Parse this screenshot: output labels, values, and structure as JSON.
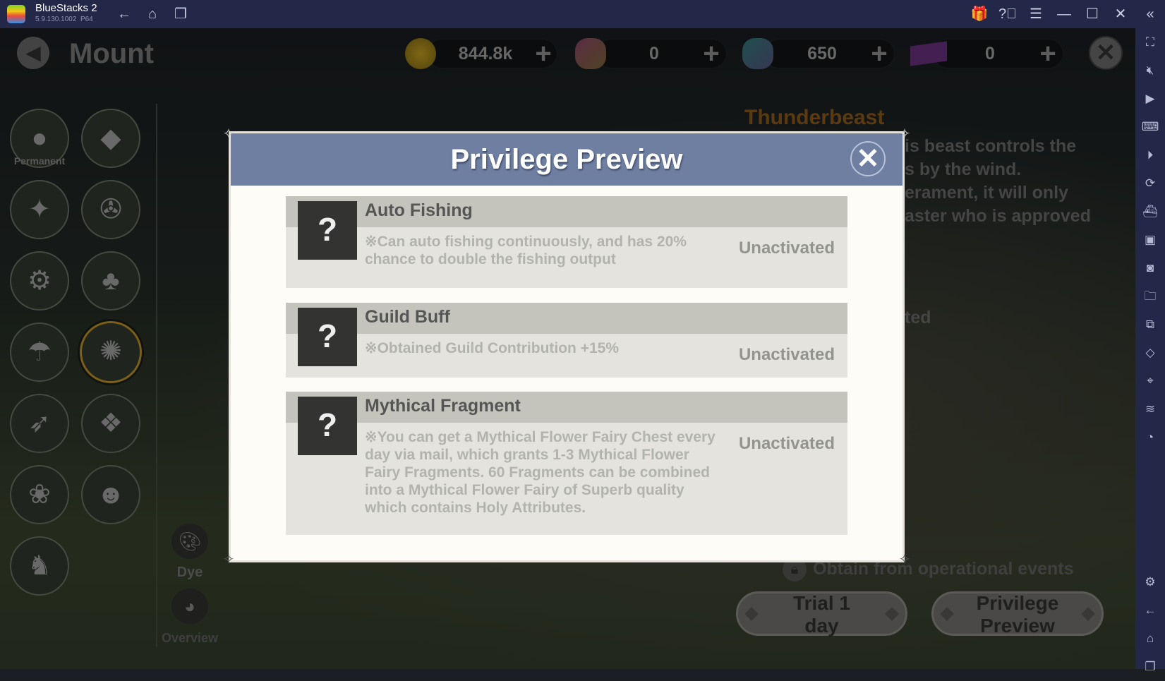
{
  "titlebar": {
    "app_name": "BlueStacks 2",
    "version": "5.9.130.1002  P64"
  },
  "page": {
    "title": "Mount"
  },
  "currencies": [
    {
      "icon": "gold-coin-icon",
      "value": "844.8k"
    },
    {
      "icon": "pink-crystal-icon",
      "value": "0"
    },
    {
      "icon": "blue-crystal-icon",
      "value": "650"
    },
    {
      "icon": "purple-ticket-icon",
      "value": "0"
    }
  ],
  "mounts": [
    {
      "label": "Permanent"
    },
    {},
    {},
    {},
    {},
    {},
    {},
    {},
    {},
    {},
    {},
    {},
    {}
  ],
  "side_actions": {
    "dye": "Dye",
    "overview": "Overview"
  },
  "detail": {
    "name": "Thunderbeast",
    "description_fragments": [
      "is beast controls the",
      "s by the wind.",
      "erament, it will only",
      "aster who is approved"
    ],
    "status_fragment": "ted",
    "obtain": "Obtain from operational events",
    "trial_button": "Trial 1 day",
    "privilege_button": "Privilege Preview"
  },
  "modal": {
    "title": "Privilege Preview",
    "privileges": [
      {
        "name": "Auto Fishing",
        "description": "※Can auto fishing continuously, and has 20% chance to double the fishing output",
        "status": "Unactivated"
      },
      {
        "name": "Guild Buff",
        "description": "※Obtained Guild Contribution +15%",
        "status": "Unactivated"
      },
      {
        "name": "Mythical Fragment",
        "description": "※You can get a Mythical Flower Fairy Chest every day via mail, which grants 1-3 Mythical Flower Fairy Fragments. 60 Fragments can be combined into a Mythical Flower Fairy of Superb quality which contains Holy Attributes.",
        "status": "Unactivated"
      }
    ]
  },
  "colors": {
    "titlebar": "#232848",
    "modal_header": "#6e7fa2",
    "accent_name": "#8a5a1c",
    "selected_ring": "#a57e20"
  }
}
